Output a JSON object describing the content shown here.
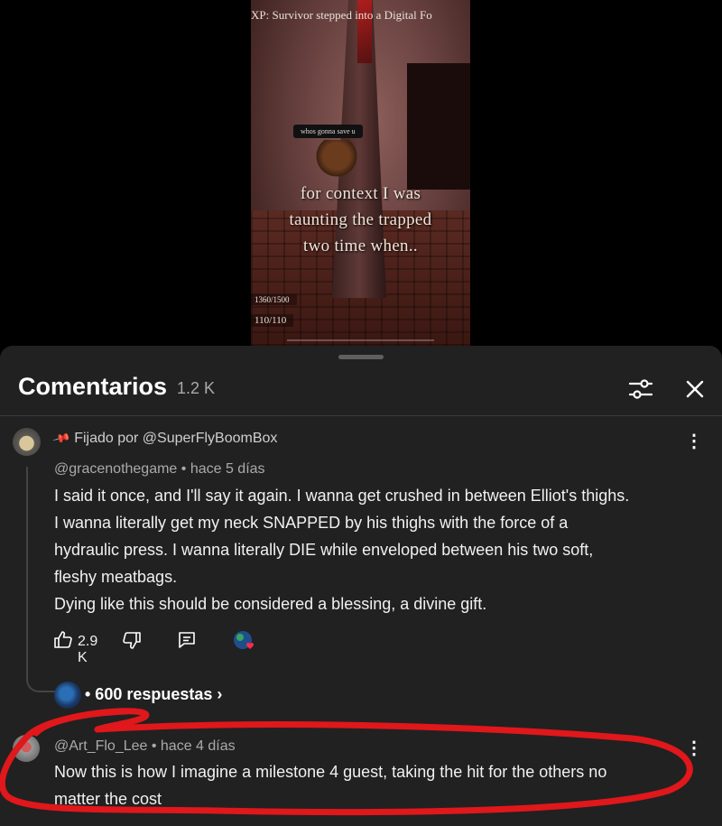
{
  "video": {
    "title": "XP: Survivor stepped into a Digital Fo",
    "speech_bubble": "whos gonna save u",
    "caption_lines": [
      "for context I was",
      "taunting the trapped",
      "two time when.."
    ],
    "stat_top": "1360/1500",
    "stat_bottom": "110/110"
  },
  "comments_panel": {
    "title": "Comentarios",
    "count": "1.2 K",
    "filter_icon": "sliders-icon",
    "close_icon": "close-icon"
  },
  "comments": [
    {
      "pinned_label": "Fijado por @SuperFlyBoomBox",
      "author": "@gracenothegame",
      "time": "hace 5 días",
      "meta": "@gracenothegame • hace 5 días",
      "lines": [
        "I said it once, and I'll say it again. I wanna get crushed in between Elliot's thighs.",
        "I wanna literally get my neck SNAPPED by his thighs with the force of a",
        "hydraulic press. I wanna literally DIE while enveloped between his two soft,",
        "fleshy meatbags.",
        "Dying like this should be considered a blessing, a divine gift."
      ],
      "likes": "2.9 K",
      "replies_label": "• 600 respuestas ›"
    },
    {
      "author": "@Art_Flo_Lee",
      "time": "hace 4 días",
      "meta": "@Art_Flo_Lee • hace 4 días",
      "lines": [
        "Now this is how I imagine a milestone 4 guest, taking the hit for the others no",
        "matter the cost"
      ]
    }
  ],
  "colors": {
    "panel_bg": "#212121",
    "text": "#f1f1f1",
    "secondary_text": "#aaaaaa",
    "scribble": "#e0171b"
  }
}
